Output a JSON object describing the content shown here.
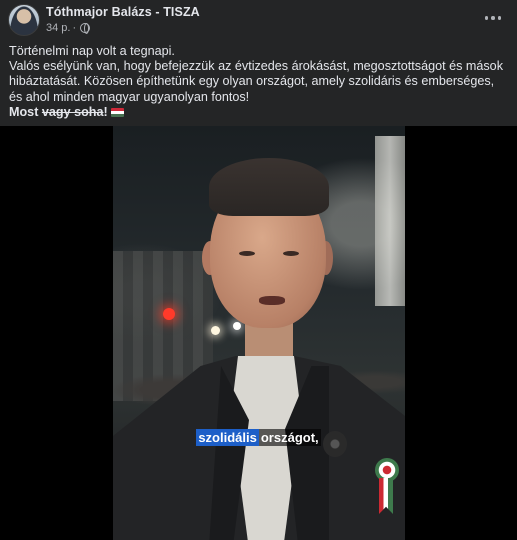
{
  "post": {
    "author": "Tóthmajor Balázs - TISZA",
    "time": "34 p.",
    "separator": "·",
    "privacy_icon": "globe-icon",
    "more_icon": "more-dots-icon",
    "text": {
      "line1": "Történelmi nap volt a tegnapi.",
      "paragraph": "Valós esélyünk van, hogy befejezzük az évtizedes árokásást, megosztottságot és mások hibáztatását. Közösen építhetünk egy olyan országot, amely szolidáris és emberséges, és ahol minden magyar ugyanolyan fontos!",
      "closing_bold": "Most",
      "closing_strike": "vagy soha",
      "closing_end": "!",
      "emoji": "flag-hungary-icon"
    }
  },
  "video": {
    "caption_highlight": "szolidális",
    "caption_rest": "országot,"
  },
  "colors": {
    "background": "#242526",
    "text": "#e4e6eb",
    "secondary_text": "#b0b3b8",
    "caption_highlight": "#1d5fc8"
  }
}
